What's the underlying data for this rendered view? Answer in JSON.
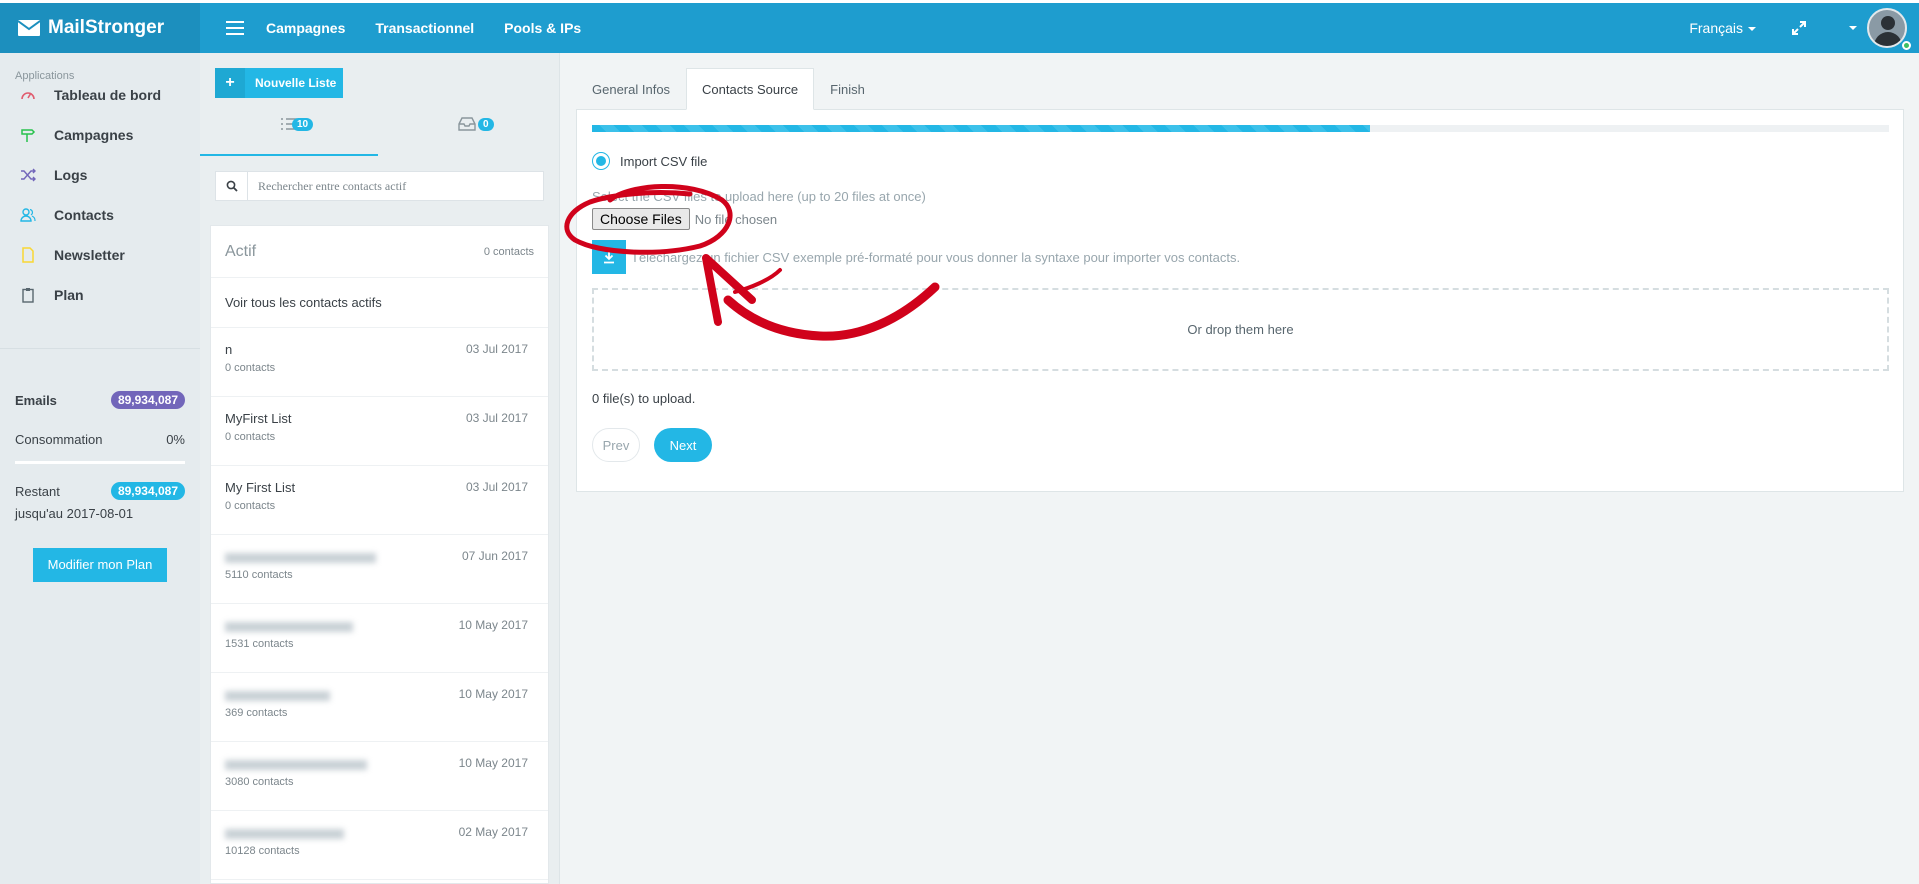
{
  "brand": {
    "name": "MailStronger"
  },
  "nav": {
    "items": [
      "Campagnes",
      "Transactionnel",
      "Pools & IPs"
    ]
  },
  "topbar": {
    "language": "Français"
  },
  "sidebar": {
    "heading": "Applications",
    "items": [
      {
        "label": "Tableau de bord",
        "icon": "dashboard-icon",
        "color": "#e05d6f"
      },
      {
        "label": "Campagnes",
        "icon": "signpost-icon",
        "color": "#27c24c"
      },
      {
        "label": "Logs",
        "icon": "shuffle-icon",
        "color": "#7266ba"
      },
      {
        "label": "Contacts",
        "icon": "users-icon",
        "color": "#23b7e5"
      },
      {
        "label": "Newsletter",
        "icon": "file-icon",
        "color": "#fad733"
      },
      {
        "label": "Plan",
        "icon": "clipboard-icon",
        "color": "#58666e"
      }
    ],
    "stats": {
      "emails_label": "Emails",
      "emails_value": "89,934,087",
      "emails_color": "#7266ba",
      "consumption_label": "Consommation",
      "consumption_value": "0%",
      "consumption_fraction": 0,
      "remaining_label": "Restant",
      "remaining_value": "89,934,087",
      "remaining_color": "#23b7e5",
      "until_label": "jusqu'au 2017-08-01"
    },
    "plan_button": "Modifier mon Plan"
  },
  "lists": {
    "new_button": "Nouvelle Liste",
    "tabs": [
      {
        "icon": "list-icon",
        "count": "10"
      },
      {
        "icon": "inbox-icon",
        "count": "0"
      }
    ],
    "search_placeholder": "Rechercher entre contacts actif",
    "panel_title": "Actif",
    "panel_count": "0 contacts",
    "all_link": "Voir tous les contacts actifs",
    "rows": [
      {
        "name": "n",
        "count": "0 contacts",
        "date": "03 Jul 2017",
        "blurred": false
      },
      {
        "name": "MyFirst List",
        "count": "0 contacts",
        "date": "03 Jul 2017",
        "blurred": false
      },
      {
        "name": "My First List",
        "count": "0 contacts",
        "date": "03 Jul 2017",
        "blurred": false
      },
      {
        "name": "",
        "count": "5110 contacts",
        "date": "07 Jun 2017",
        "blurred": true
      },
      {
        "name": "",
        "count": "1531 contacts",
        "date": "10 May 2017",
        "blurred": true
      },
      {
        "name": "",
        "count": "369 contacts",
        "date": "10 May 2017",
        "blurred": true
      },
      {
        "name": "",
        "count": "3080 contacts",
        "date": "10 May 2017",
        "blurred": true
      },
      {
        "name": "",
        "count": "10128 contacts",
        "date": "02 May 2017",
        "blurred": true
      }
    ]
  },
  "wizard": {
    "tabs": [
      "General Infos",
      "Contacts Source",
      "Finish"
    ],
    "active_tab": 1,
    "progress_fraction": 0.6,
    "radio_label": "Import CSV file",
    "hint": "Select the CSV files to upload here (up to 20 files at once)",
    "choose_button": "Choose Files",
    "no_file": "No file chosen",
    "download_text": "Téléchargez un fichier CSV exemple pré-formaté pour vous donner la syntaxe pour importer vos contacts.",
    "dropzone": "Or drop them here",
    "upload_count": "0 file(s) to upload.",
    "prev": "Prev",
    "next": "Next"
  },
  "accent_color": "#23b7e5",
  "annotation_color": "#d0021b"
}
